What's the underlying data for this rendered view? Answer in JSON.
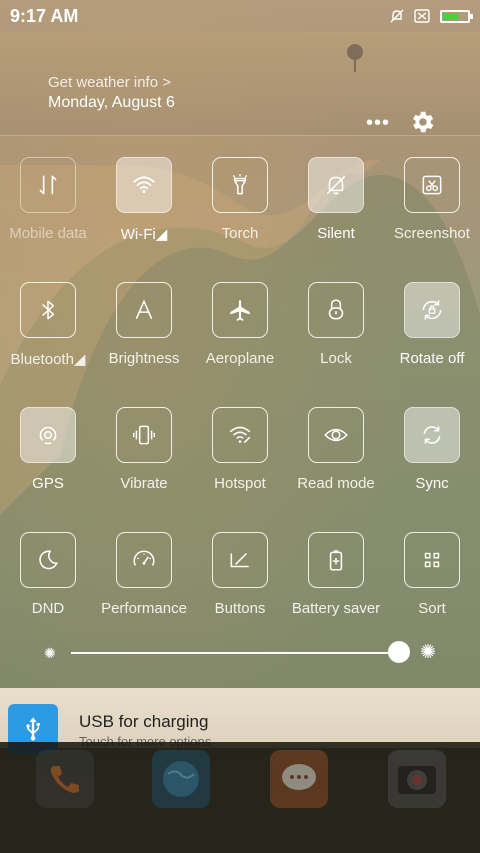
{
  "status": {
    "time": "9:17 AM",
    "battery_level": 0.7
  },
  "header": {
    "weather": "Get weather info >",
    "date": "Monday, August 6"
  },
  "tiles": [
    {
      "label": "Mobile data",
      "icon": "mobile-data-icon",
      "state": "disabled"
    },
    {
      "label": "Wi-Fi◢",
      "icon": "wifi-icon",
      "state": "active"
    },
    {
      "label": "Torch",
      "icon": "torch-icon",
      "state": "normal"
    },
    {
      "label": "Silent",
      "icon": "silent-icon",
      "state": "active"
    },
    {
      "label": "Screenshot",
      "icon": "screenshot-icon",
      "state": "normal"
    },
    {
      "label": "Bluetooth◢",
      "icon": "bluetooth-icon",
      "state": "normal"
    },
    {
      "label": "Brightness",
      "icon": "brightness-icon",
      "state": "normal"
    },
    {
      "label": "Aeroplane",
      "icon": "aeroplane-icon",
      "state": "normal"
    },
    {
      "label": "Lock",
      "icon": "lock-icon",
      "state": "normal"
    },
    {
      "label": "Rotate off",
      "icon": "rotate-icon",
      "state": "active"
    },
    {
      "label": "GPS",
      "icon": "gps-icon",
      "state": "active"
    },
    {
      "label": "Vibrate",
      "icon": "vibrate-icon",
      "state": "normal"
    },
    {
      "label": "Hotspot",
      "icon": "hotspot-icon",
      "state": "normal"
    },
    {
      "label": "Read mode",
      "icon": "read-mode-icon",
      "state": "normal"
    },
    {
      "label": "Sync",
      "icon": "sync-icon",
      "state": "active"
    },
    {
      "label": "DND",
      "icon": "dnd-icon",
      "state": "normal"
    },
    {
      "label": "Performance",
      "icon": "performance-icon",
      "state": "normal"
    },
    {
      "label": "Buttons",
      "icon": "buttons-icon",
      "state": "normal"
    },
    {
      "label": "Battery saver",
      "icon": "battery-saver-icon",
      "state": "normal"
    },
    {
      "label": "Sort",
      "icon": "sort-icon",
      "state": "normal"
    }
  ],
  "brightness": {
    "level": 1.0
  },
  "notification": {
    "title": "USB for charging",
    "subtitle": "Touch for more options"
  },
  "dock": {
    "apps": [
      "phone-app-icon",
      "browser-app-icon",
      "messaging-app-icon",
      "camera-app-icon"
    ]
  },
  "colors": {
    "usb_icon": "#2c9be3",
    "battery_fill": "#4cd03f"
  }
}
